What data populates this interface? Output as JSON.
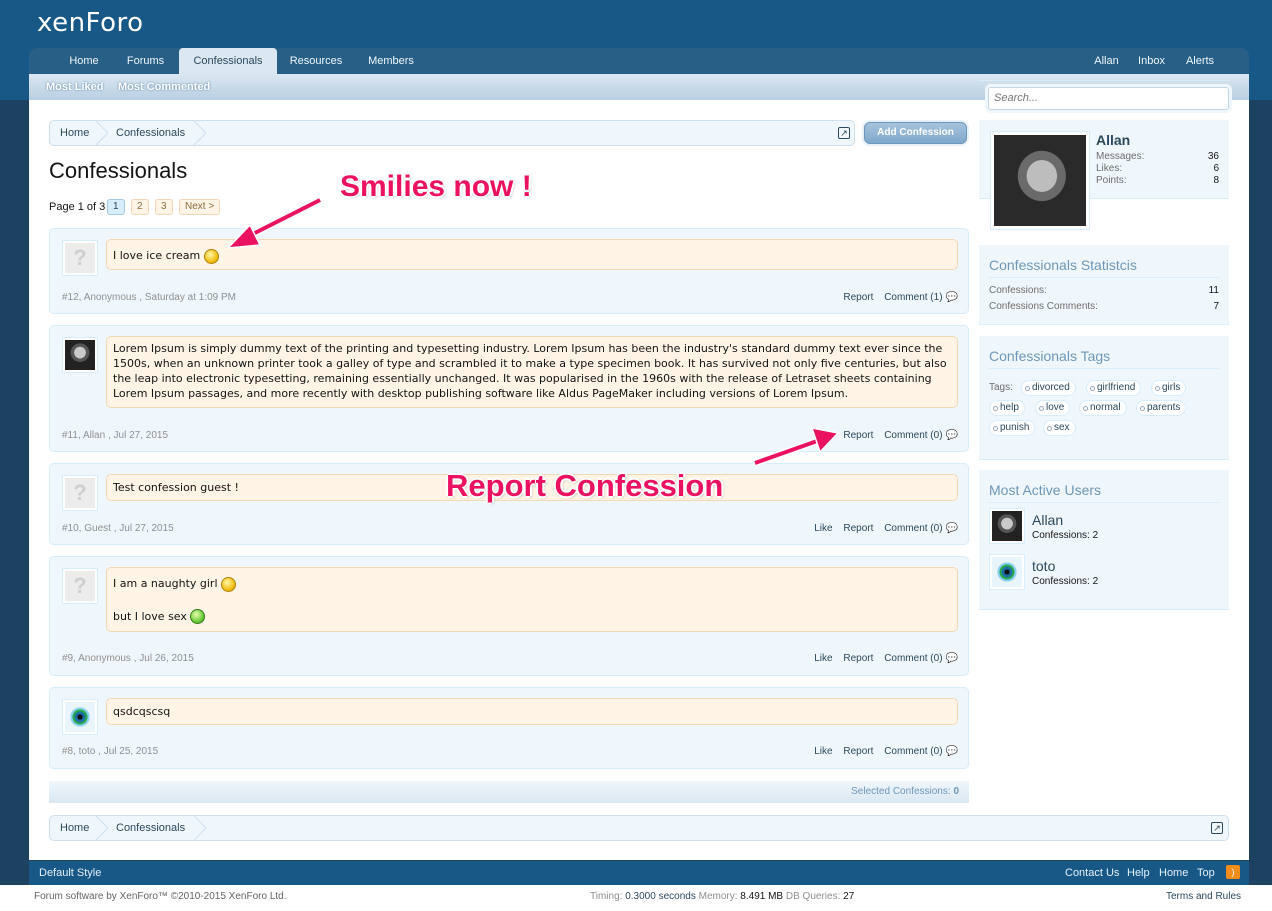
{
  "logo": {
    "text": "xenForo"
  },
  "nav": {
    "tabs": [
      {
        "label": "Home"
      },
      {
        "label": "Forums"
      },
      {
        "label": "Confessionals"
      },
      {
        "label": "Resources"
      },
      {
        "label": "Members"
      }
    ],
    "user": "Allan",
    "inbox": "Inbox",
    "alerts": "Alerts",
    "sub": [
      "Most Liked",
      "Most Commented"
    ]
  },
  "search": {
    "placeholder": "Search..."
  },
  "breadcrumb": {
    "items": [
      "Home",
      "Confessionals"
    ]
  },
  "add_button": "Add Confession",
  "page_title": "Confessionals",
  "pager": {
    "label": "Page 1 of 3",
    "pages": [
      "1",
      "2",
      "3"
    ],
    "next": "Next >"
  },
  "confessions": [
    {
      "text": "I love ice cream",
      "meta": "#12, Anonymous , Saturday at 1:09 PM",
      "report": "Report",
      "comment": "Comment (1)"
    },
    {
      "text": "Lorem Ipsum is simply dummy text of the printing and typesetting industry. Lorem Ipsum has been the industry's standard dummy text ever since the 1500s, when an unknown printer took a galley of type and scrambled it to make a type specimen book. It has survived not only five centuries, but also the leap into electronic typesetting, remaining essentially unchanged. It was popularised in the 1960s with the release of Letraset sheets containing Lorem Ipsum passages, and more recently with desktop publishing software like Aldus PageMaker including versions of Lorem Ipsum.",
      "meta": "#11, Allan , Jul 27, 2015",
      "report": "Report",
      "comment": "Comment (0)"
    },
    {
      "text": "Test confession guest !",
      "meta": "#10, Guest , Jul 27, 2015",
      "like": "Like",
      "report": "Report",
      "comment": "Comment (0)"
    },
    {
      "text": "I am a naughty girl",
      "text2": "but I love sex",
      "meta": "#9, Anonymous , Jul 26, 2015",
      "like": "Like",
      "report": "Report",
      "comment": "Comment (0)"
    },
    {
      "text": "qsdcqscsq",
      "meta": "#8, toto , Jul 25, 2015",
      "like": "Like",
      "report": "Report",
      "comment": "Comment (0)"
    }
  ],
  "selected": {
    "label": "Selected Confessions:",
    "count": "0"
  },
  "profile": {
    "name": "Allan",
    "stats": [
      {
        "label": "Messages:",
        "value": "36"
      },
      {
        "label": "Likes:",
        "value": "6"
      },
      {
        "label": "Points:",
        "value": "8"
      }
    ]
  },
  "stats_block": {
    "title": "Confessionals Statistcis",
    "rows": [
      {
        "label": "Confessions:",
        "value": "11"
      },
      {
        "label": "Confessions Comments:",
        "value": "7"
      }
    ]
  },
  "tags_block": {
    "title": "Confessionals Tags",
    "label": "Tags:",
    "tags": [
      "divorced",
      "girlfriend",
      "girls",
      "help",
      "love",
      "normal",
      "parents",
      "punish",
      "sex"
    ]
  },
  "active_block": {
    "title": "Most Active Users",
    "users": [
      {
        "name": "Allan",
        "count": "Confessions: 2"
      },
      {
        "name": "toto",
        "count": "Confessions: 2"
      }
    ]
  },
  "footer": {
    "style": "Default Style",
    "links": [
      "Contact Us",
      "Help",
      "Home",
      "Top"
    ]
  },
  "bottom": {
    "copyright": "Forum software by XenForo™ ©2010-2015 XenForo Ltd.",
    "timing_label": "Timing:",
    "timing": "0.3000 seconds",
    "memory_label": "Memory:",
    "memory": "8.491 MB",
    "db_label": "DB Queries:",
    "db": "27",
    "terms": "Terms and Rules"
  },
  "annotations": {
    "smilies": "Smilies now !",
    "report": "Report Confession"
  },
  "colors": {
    "header": "#185886",
    "accent": "#2b485c",
    "bubble": "#fff4e5",
    "annotation": "#ec1262"
  }
}
